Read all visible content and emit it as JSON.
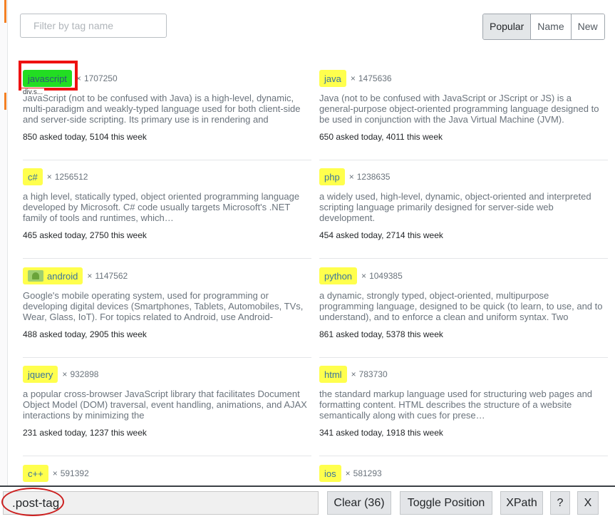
{
  "filter": {
    "placeholder": "Filter by tag name"
  },
  "sort": {
    "options": [
      "Popular",
      "Name",
      "New"
    ],
    "active": "Popular"
  },
  "tags": [
    {
      "name": "javascript",
      "mult": "×",
      "count": "1707250",
      "description": "JavaScript (not to be confused with Java) is a high-level, dynamic, multi-paradigm and weakly-typed language used for both client-side and server-side scripting. Its primary use is in rendering and",
      "stats": "850 asked today, 5104 this week"
    },
    {
      "name": "java",
      "mult": "×",
      "count": "1475636",
      "description": "Java (not to be confused with JavaScript or JScript or JS) is a general-purpose object-oriented programming language designed to be used in conjunction with the Java Virtual Machine (JVM).",
      "stats": "650 asked today, 4011 this week"
    },
    {
      "name": "c#",
      "mult": "×",
      "count": "1256512",
      "description": "a high level, statically typed, object oriented programming language developed by Microsoft. C# code usually targets Microsoft's .NET family of tools and runtimes, which…",
      "stats": "465 asked today, 2750 this week"
    },
    {
      "name": "php",
      "mult": "×",
      "count": "1238635",
      "description": "a widely used, high-level, dynamic, object-oriented and interpreted scripting language primarily designed for server-side web development.",
      "stats": "454 asked today, 2714 this week"
    },
    {
      "name": "android",
      "mult": "×",
      "count": "1147562",
      "description": "Google's mobile operating system, used for programming or developing digital devices (Smartphones, Tablets, Automobiles, TVs, Wear, Glass, IoT). For topics related to Android, use Android-",
      "stats": "488 asked today, 2905 this week"
    },
    {
      "name": "python",
      "mult": "×",
      "count": "1049385",
      "description": "a dynamic, strongly typed, object-oriented, multipurpose programming language, designed to be quick (to learn, to use, and to understand), and to enforce a clean and uniform syntax. Two",
      "stats": "861 asked today, 5378 this week"
    },
    {
      "name": "jquery",
      "mult": "×",
      "count": "932898",
      "description": "a popular cross-browser JavaScript library that facilitates Document Object Model (DOM) traversal, event handling, animations, and AJAX interactions by minimizing the",
      "stats": "231 asked today, 1237 this week"
    },
    {
      "name": "html",
      "mult": "×",
      "count": "783730",
      "description": "the standard markup language used for structuring web pages and formatting content. HTML describes the structure of a website semantically along with cues for prese…",
      "stats": "341 asked today, 1918 this week"
    },
    {
      "name": "c++",
      "mult": "×",
      "count": "591392"
    },
    {
      "name": "ios",
      "mult": "×",
      "count": "581293"
    }
  ],
  "highlight": {
    "ghost_label": "div.s..."
  },
  "toolbar": {
    "selector_value": ".post-tag",
    "clear_label": "Clear (36)",
    "toggle_label": "Toggle Position",
    "xpath_label": "XPath",
    "help_label": "?",
    "close_label": "X"
  },
  "colors": {
    "tag_bg": "#ffff4d",
    "tag_selected_bg": "#22dd22",
    "highlight_border": "#ee1111"
  }
}
